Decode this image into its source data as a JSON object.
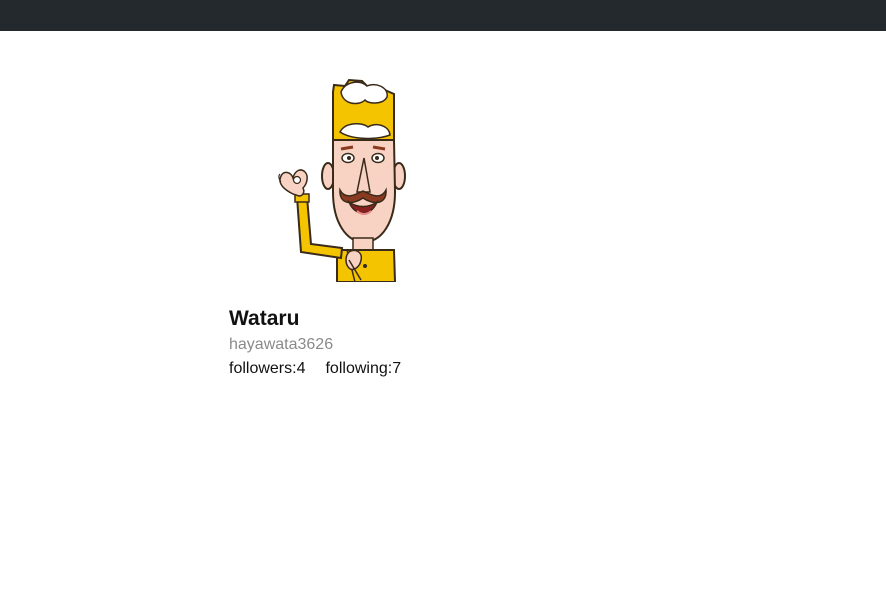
{
  "header": {
    "background": "#24292e"
  },
  "profile": {
    "avatar_icon": "chef-character-avatar",
    "name": "Wataru",
    "login": "hayawata3626",
    "followers_label": "followers:",
    "followers_count": "4",
    "following_label": "following:",
    "following_count": "7"
  }
}
